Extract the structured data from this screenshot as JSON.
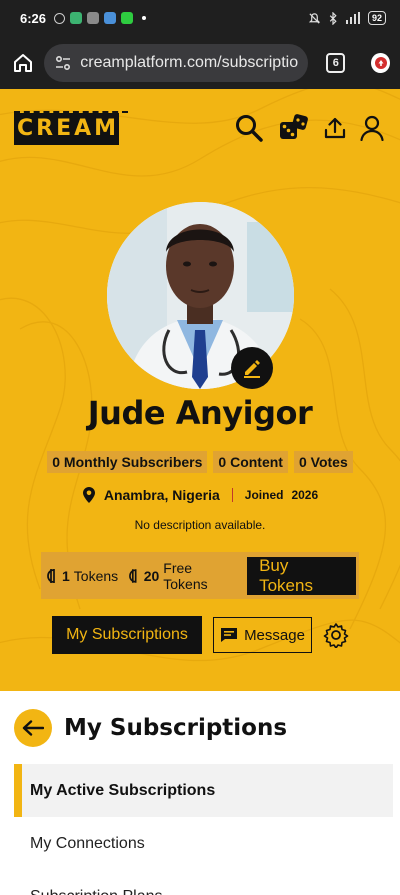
{
  "status": {
    "time": "6:26",
    "battery": "92"
  },
  "browser": {
    "url": "creamplatform.com/subscriptions",
    "tab_count": "6"
  },
  "brand": {
    "logo_letters": [
      "C",
      "R",
      "E",
      "A",
      "M"
    ],
    "accent_color": "#f2b513",
    "dark_color": "#111111"
  },
  "profile": {
    "name": "Jude Anyigor",
    "stats": [
      "0 Monthly Subscribers",
      "0 Content",
      "0 Votes"
    ],
    "location": "Anambra, Nigeria",
    "joined_label": "Joined",
    "joined_year": "2026",
    "description": "No description available."
  },
  "tokens": {
    "tokens_count": "1",
    "tokens_label": "Tokens",
    "free_count": "20",
    "free_label": "Free Tokens",
    "buy_label": "Buy Tokens"
  },
  "actions": {
    "my_subscriptions": "My Subscriptions",
    "message": "Message"
  },
  "section": {
    "title": "My Subscriptions",
    "menu": [
      {
        "label": "My Active Subscriptions",
        "active": true
      },
      {
        "label": "My Connections",
        "active": false
      },
      {
        "label": "Subscription Plans",
        "active": false
      }
    ]
  },
  "icons": {
    "header": [
      "search-icon",
      "dice-icon",
      "upload-icon",
      "user-icon"
    ]
  }
}
